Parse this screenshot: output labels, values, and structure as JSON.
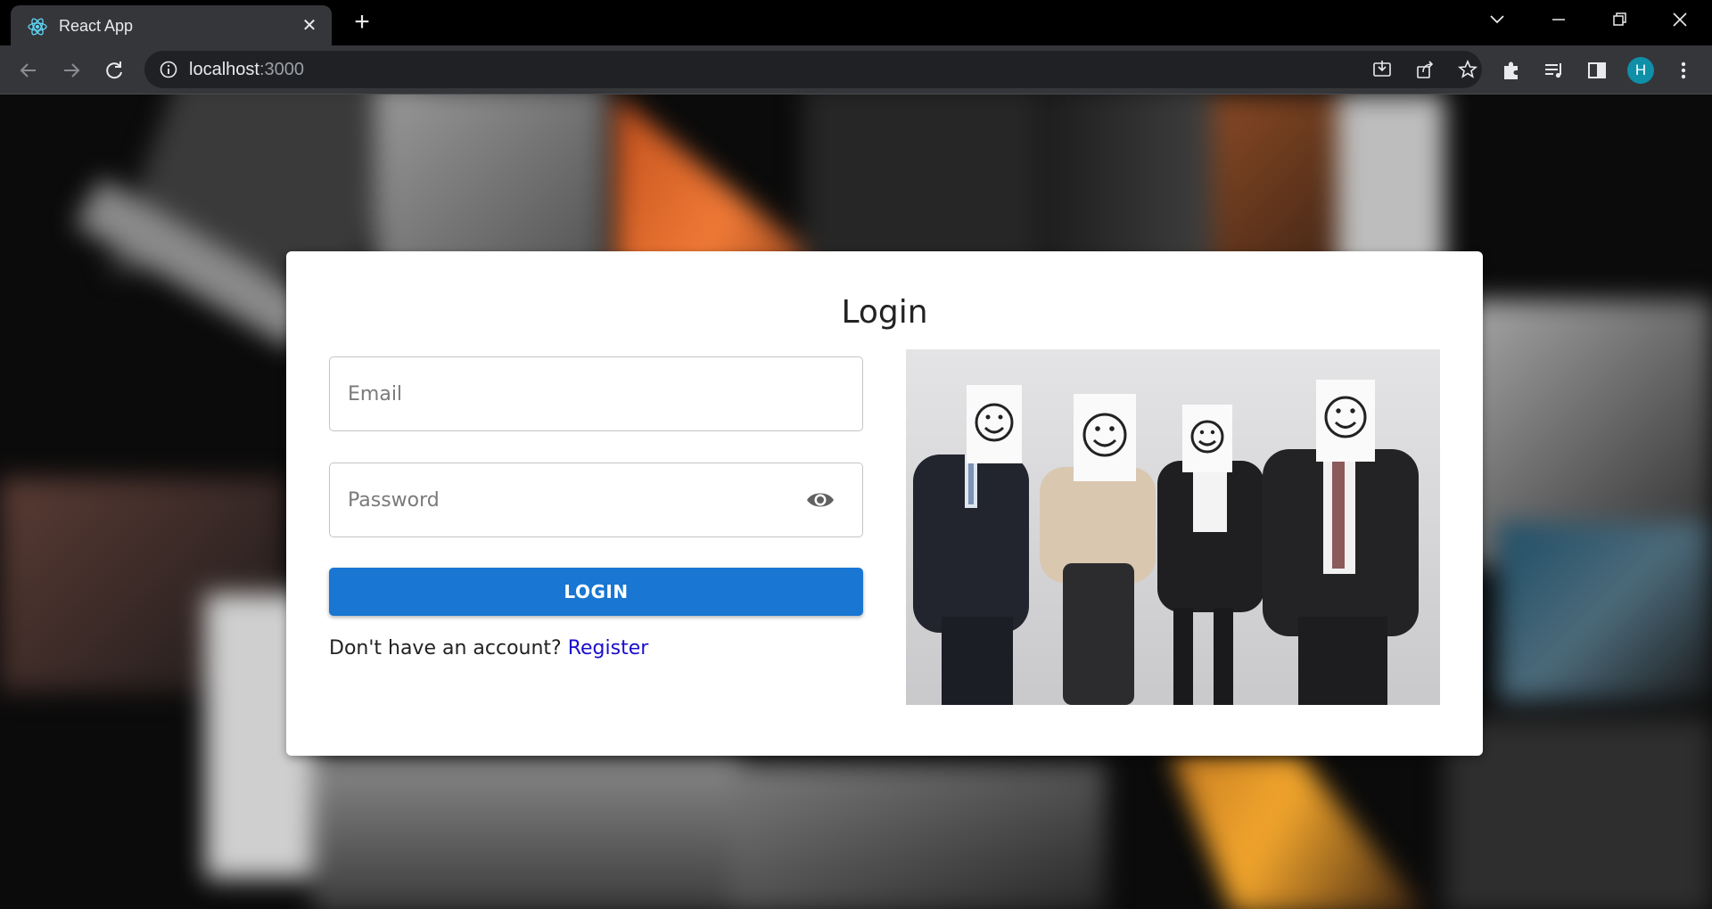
{
  "browser": {
    "tab_title": "React App",
    "url_host": "localhost",
    "url_port": ":3000",
    "profile_initial": "H"
  },
  "login": {
    "title": "Login",
    "email_placeholder": "Email",
    "password_placeholder": "Password",
    "button_label": "LOGIN",
    "register_prompt": "Don't have an account? ",
    "register_link": "Register"
  },
  "colors": {
    "primary": "#1976d2",
    "link": "#1a0dcc",
    "avatar": "#0f8fa8"
  }
}
